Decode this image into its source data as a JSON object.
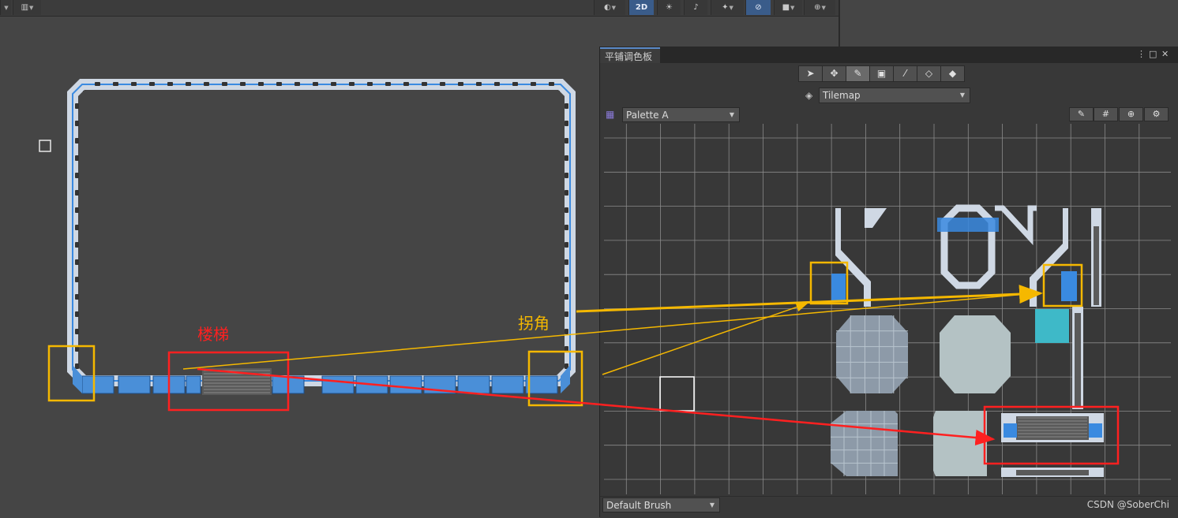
{
  "toolbar": {
    "left_icon": "layout-dropdown-icon",
    "grid_icon": "grid-snapping-icon",
    "shading_icon": "shading-mode-icon",
    "mode_2d": "2D",
    "lighting_icon": "lighting-icon",
    "audio_icon": "audio-icon",
    "effects_icon": "effects-icon",
    "visibility_icon": "hidden-visibility-icon",
    "camera_icon": "camera-icon",
    "gizmos_icon": "gizmos-icon"
  },
  "palette_window": {
    "tab_title": "平铺调色板",
    "tools": [
      "select-tool-icon",
      "move-tool-icon",
      "paint-brush-tool-icon",
      "box-fill-tool-icon",
      "picker-tool-icon",
      "eraser-tool-icon",
      "fill-tool-icon"
    ],
    "active_tool_index": 2,
    "tilemap_dropdown": "Tilemap",
    "palette_dropdown": "Palette A",
    "edit_icons": [
      "edit-pencil-icon",
      "grid-toggle-icon",
      "gizmo-toggle-icon",
      "settings-icon"
    ],
    "brush_dropdown": "Default Brush"
  },
  "annotations": {
    "stairs_label": "楼梯",
    "corner_label": "拐角",
    "stairs_color": "#ff2020",
    "corner_color": "#f5b800"
  },
  "watermark": "CSDN @SoberChi"
}
